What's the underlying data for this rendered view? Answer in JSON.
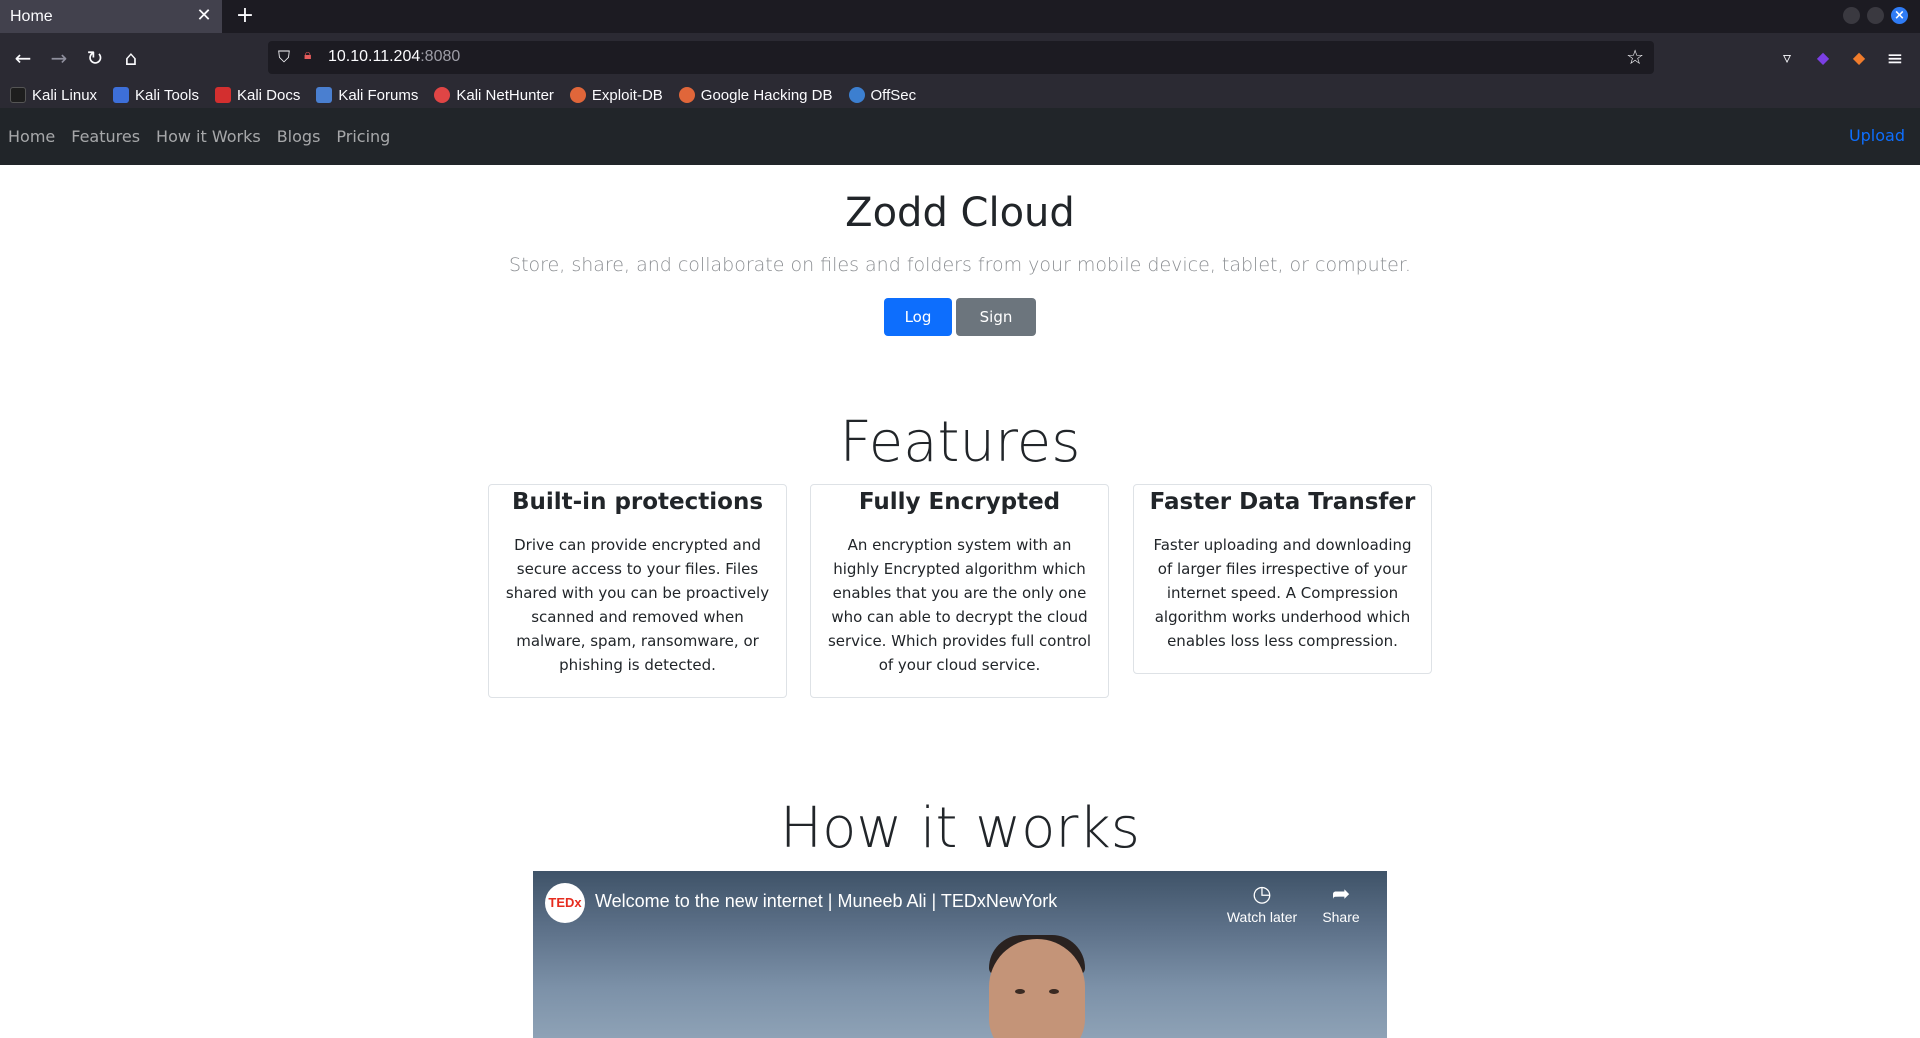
{
  "browser": {
    "tab_title": "Home",
    "tab_close": "✕",
    "new_tab": "+",
    "url_host": "10.10.11.204",
    "url_port": ":8080",
    "bookmarks": [
      {
        "label": "Kali Linux",
        "icon": "kali-dragon-icon",
        "color": "#1e1e1e"
      },
      {
        "label": "Kali Tools",
        "icon": "kali-tools-icon",
        "color": "#3d6fd9"
      },
      {
        "label": "Kali Docs",
        "icon": "kali-docs-icon",
        "color": "#d32f2f"
      },
      {
        "label": "Kali Forums",
        "icon": "kali-forums-icon",
        "color": "#4a7fd0"
      },
      {
        "label": "Kali NetHunter",
        "icon": "nethunter-icon",
        "color": "#e04545"
      },
      {
        "label": "Exploit-DB",
        "icon": "exploit-db-icon",
        "color": "#e0663a"
      },
      {
        "label": "Google Hacking DB",
        "icon": "ghdb-icon",
        "color": "#e0663a"
      },
      {
        "label": "OffSec",
        "icon": "offsec-icon",
        "color": "#3c7fd0"
      }
    ]
  },
  "site": {
    "nav": [
      "Home",
      "Features",
      "How it Works",
      "Blogs",
      "Pricing"
    ],
    "upload": "Upload",
    "accent": "#0d6efd"
  },
  "hero": {
    "title": "Zodd Cloud",
    "subtitle": "Store, share, and collaborate on files and folders from your mobile device, tablet, or computer.",
    "login": "Log in",
    "signup": "Sign Up"
  },
  "features": {
    "heading": "Features",
    "cards": [
      {
        "title": "Built-in protections",
        "text": "Drive can provide encrypted and secure access to your files. Files shared with you can be proactively scanned and removed when malware, spam, ransomware, or phishing is detected."
      },
      {
        "title": "Fully Encrypted",
        "text": "An encryption system with an highly Encrypted algorithm which enables that you are the only one who can able to decrypt the cloud service. Which provides full control of your cloud service."
      },
      {
        "title": "Faster Data Transfer",
        "text": "Faster uploading and downloading of larger files irrespective of your internet speed. A Compression algorithm works underhood which enables loss less compression."
      }
    ]
  },
  "how": {
    "heading": "How it works",
    "video_logo": "TEDx",
    "video_title": "Welcome to the new internet | Muneeb Ali | TEDxNewYork",
    "watch_later": "Watch later",
    "share": "Share"
  }
}
